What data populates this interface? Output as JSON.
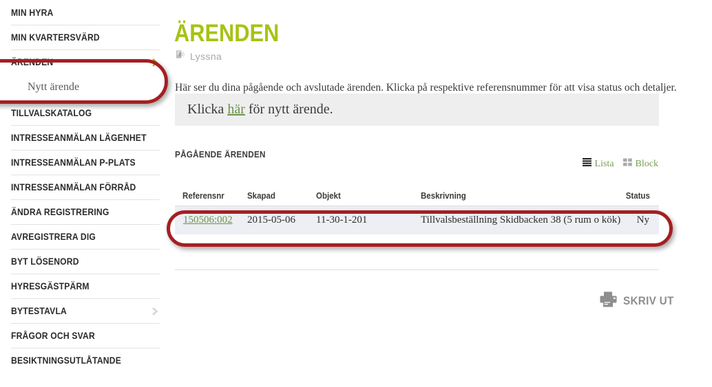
{
  "sidebar": {
    "items": [
      {
        "label": "Min hyra",
        "chevron": "none",
        "name": "min-hyra"
      },
      {
        "label": "Min kvartersvärd",
        "chevron": "none",
        "name": "min-kvartersvard"
      },
      {
        "label": "Ärenden",
        "chevron": "green",
        "name": "arenden"
      },
      {
        "label": "Tillvalskatalog",
        "chevron": "none",
        "name": "tillvalskatalog"
      },
      {
        "label": "Intresseanmälan lägenhet",
        "chevron": "none",
        "name": "intresseanmalan-lagenhet"
      },
      {
        "label": "Intresseanmälan P-plats",
        "chevron": "none",
        "name": "intresseanmalan-p-plats"
      },
      {
        "label": "Intresseanmälan förråd",
        "chevron": "none",
        "name": "intresseanmalan-forrad"
      },
      {
        "label": "Ändra registrering",
        "chevron": "none",
        "name": "andra-registrering"
      },
      {
        "label": "Avregistrera dig",
        "chevron": "none",
        "name": "avregistrera-dig"
      },
      {
        "label": "Byt lösenord",
        "chevron": "none",
        "name": "byt-losenord"
      },
      {
        "label": "Hyresgästpärm",
        "chevron": "none",
        "name": "hyresgastparm"
      },
      {
        "label": "Bytestavla",
        "chevron": "gray",
        "name": "bytestavla"
      },
      {
        "label": "Frågor och svar",
        "chevron": "none",
        "name": "fragor-och-svar"
      },
      {
        "label": "Besiktningsutlåtande",
        "chevron": "none",
        "name": "besiktningsutlatande"
      }
    ],
    "subitem": "Nytt ärende"
  },
  "main": {
    "title": "Ärenden",
    "listen_label": "Lyssna",
    "intro": "Här ser du dina pågående och avslutade ärenden. Klicka på respektive referensnummer för att visa status och detaljer.",
    "cta_prefix": "Klicka ",
    "cta_link": "här",
    "cta_suffix": " för nytt ärende.",
    "section_heading": "Pågående ärenden",
    "view_list_label": "Lista",
    "view_block_label": "Block",
    "print_label": "Skriv ut"
  },
  "table": {
    "columns": [
      "Referensnr",
      "Skapad",
      "Objekt",
      "Beskrivning",
      "Status"
    ],
    "rows": [
      {
        "referensnr": "150506:002",
        "skapad": "2015-05-06",
        "objekt": "11-30-1-201",
        "beskrivning": "Tillvalsbeställning Skidbacken 38 (5 rum o kök)",
        "status": "Ny"
      }
    ]
  },
  "colors": {
    "accent_green": "#a8c213",
    "link_green": "#6a9247",
    "annotation_red": "#a41f22",
    "row_bg": "#eeeef5",
    "cta_bg": "#eeeeee"
  }
}
